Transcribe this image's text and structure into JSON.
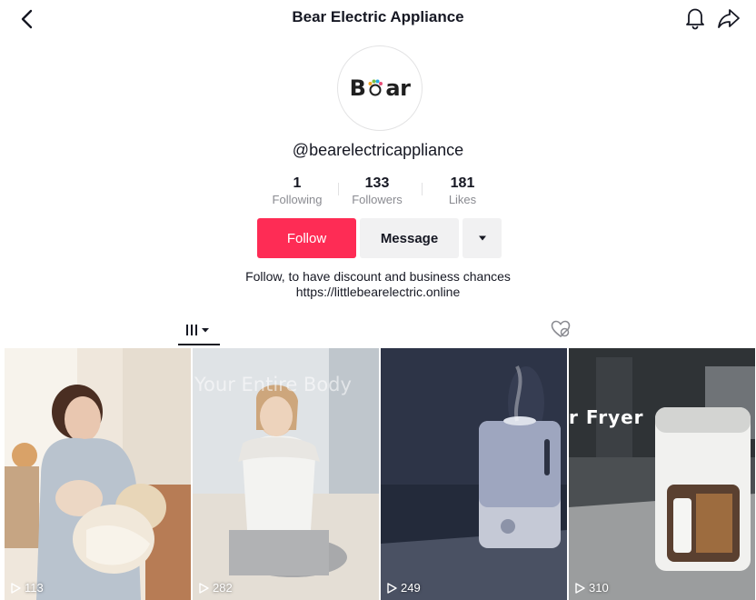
{
  "header": {
    "title": "Bear Electric Appliance"
  },
  "profile": {
    "logo": "Bear",
    "username": "@bearelectricappliance",
    "stats": [
      {
        "value": "1",
        "label": "Following"
      },
      {
        "value": "133",
        "label": "Followers"
      },
      {
        "value": "181",
        "label": "Likes"
      }
    ],
    "bio_line1": "Follow, to have discount and business chances",
    "bio_line2": "https://littlebearelectric.online"
  },
  "actions": {
    "follow_label": "Follow",
    "message_label": "Message"
  },
  "tabs": {
    "videos_icon": "grid-icon",
    "liked_icon": "liked-hidden-icon"
  },
  "videos": [
    {
      "overlay": "",
      "plays": "113"
    },
    {
      "overlay": "Your Entire Body",
      "plays": "282"
    },
    {
      "overlay": "",
      "plays": "249"
    },
    {
      "overlay": "r Fryer",
      "plays": "310"
    }
  ],
  "colors": {
    "accent": "#fe2c55",
    "secondary_button": "#f1f1f2"
  }
}
